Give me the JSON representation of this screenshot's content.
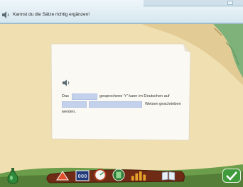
{
  "instruction": "Kannst du die Sätze richtig ergänzen!",
  "exercise": {
    "w_das": "Das",
    "w_gesprochene": "gesprochene \"r\" kann im Deutschen auf",
    "w_weisen": "Weisen geschrieben",
    "w_werden": "werden.",
    "gaps": [
      "",
      "",
      ""
    ]
  },
  "colors": {
    "banner": "#e6f0f6",
    "paper": "#fbf9f3",
    "gap": "#c3d1ec",
    "ground": "#f0dfb1",
    "check_button": "#3f9b3b"
  },
  "toolbar": {
    "icons": [
      "potion-icon",
      "arrow-icon",
      "numbers-icon",
      "gauge-icon",
      "cabinet-icon",
      "bars-icon",
      "book-icon",
      "check-icon"
    ]
  }
}
